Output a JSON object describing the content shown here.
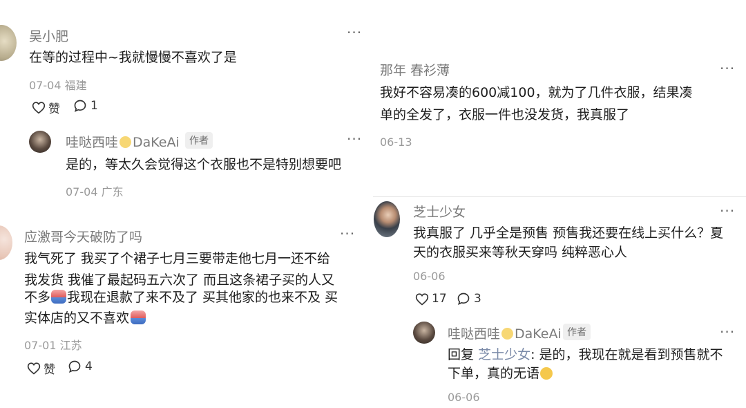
{
  "c1": {
    "user": "吴小肥",
    "text": "在等的过程中~我就慢慢不喜欢了是",
    "meta": "07-04 福建",
    "like_label": "赞",
    "reply_count": "1",
    "reply": {
      "user_prefix": "哇哒西哇",
      "user_suffix": "DaKeAi",
      "tag": "作者",
      "text": "是的，等太久会觉得这个衣服也不是特别想要吧",
      "meta": "07-04 广东"
    }
  },
  "c2": {
    "user": "应激哥今天破防了吗",
    "lines": [
      "我气死了 我买了个裙子七月三要带走他七月一还不给",
      "我发货 我催了最起码五六次了 而且这条裙子买的人又",
      "不多",
      "我现在退款了来不及了 买其他家的也来不及 买",
      "实体店的又不喜欢"
    ],
    "meta": "07-01 江苏",
    "like_label": "赞",
    "reply_count": "4"
  },
  "c3": {
    "user": "那年 春衫薄",
    "lines": [
      "我好不容易凑的600减100，就为了几件衣服，结果凑",
      "单的全发了，衣服一件也没发货，我真服了"
    ],
    "meta": "06-13"
  },
  "c4": {
    "user": "芝士少女",
    "lines": [
      "我真服了 几乎全是预售 预售我还要在线上买什么？夏",
      "天的衣服买来等秋天穿吗 纯粹恶心人"
    ],
    "meta": "06-06",
    "like_count": "17",
    "reply_count": "3",
    "reply": {
      "user_prefix": "哇哒西哇",
      "user_suffix": "DaKeAi",
      "tag": "作者",
      "reply_word": "回复",
      "mention": "芝士少女",
      "line1_rest": ": 是的，我现在就是看到预售就不",
      "line2": "下单，真的无语",
      "meta": "06-06"
    }
  },
  "more_label": "···",
  "colors": {
    "text": "#1e1e1e",
    "name": "#7a7a7a",
    "meta": "#9a9a9a",
    "mention": "#7a8aa8"
  },
  "icons": [
    "heart-icon",
    "comment-bubble-icon",
    "more-dots-icon",
    "smiley-emoji-icon",
    "grimace-emoji-icon",
    "sweat-emoji-icon"
  ]
}
